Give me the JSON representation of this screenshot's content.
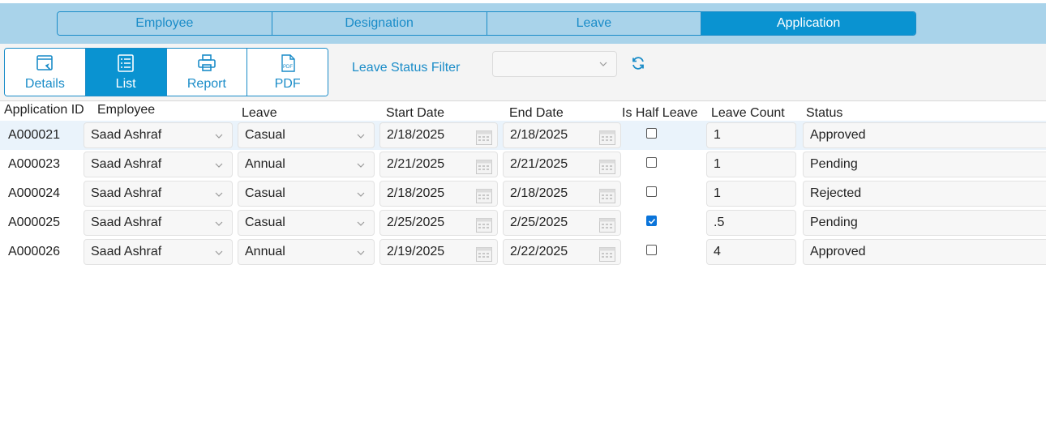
{
  "nav_tabs": [
    {
      "label": "Employee",
      "active": false
    },
    {
      "label": "Designation",
      "active": false
    },
    {
      "label": "Leave",
      "active": false
    },
    {
      "label": "Application",
      "active": true
    }
  ],
  "view_buttons": [
    {
      "label": "Details",
      "icon": "details-icon",
      "active": false
    },
    {
      "label": "List",
      "icon": "list-icon",
      "active": true
    },
    {
      "label": "Report",
      "icon": "printer-icon",
      "active": false
    },
    {
      "label": "PDF",
      "icon": "pdf-icon",
      "active": false
    }
  ],
  "filter": {
    "label": "Leave Status Filter",
    "value": ""
  },
  "table": {
    "columns": [
      "Application ID",
      "Employee",
      "Leave",
      "Start Date",
      "End Date",
      "Is Half Leave",
      "Leave Count",
      "Status"
    ],
    "rows": [
      {
        "id": "A000021",
        "employee": "Saad Ashraf",
        "leave": "Casual",
        "start": "2/18/2025",
        "end": "2/18/2025",
        "half": false,
        "count": "1",
        "status": "Approved",
        "selected": true
      },
      {
        "id": "A000023",
        "employee": "Saad Ashraf",
        "leave": "Annual",
        "start": "2/21/2025",
        "end": "2/21/2025",
        "half": false,
        "count": "1",
        "status": "Pending",
        "selected": false
      },
      {
        "id": "A000024",
        "employee": "Saad Ashraf",
        "leave": "Casual",
        "start": "2/18/2025",
        "end": "2/18/2025",
        "half": false,
        "count": "1",
        "status": "Rejected",
        "selected": false
      },
      {
        "id": "A000025",
        "employee": "Saad Ashraf",
        "leave": "Casual",
        "start": "2/25/2025",
        "end": "2/25/2025",
        "half": true,
        "count": ".5",
        "status": "Pending",
        "selected": false
      },
      {
        "id": "A000026",
        "employee": "Saad Ashraf",
        "leave": "Annual",
        "start": "2/19/2025",
        "end": "2/22/2025",
        "half": false,
        "count": "4",
        "status": "Approved",
        "selected": false
      }
    ]
  },
  "colors": {
    "accent": "#0a93d1",
    "nav_bg": "#a9d3ea",
    "link": "#1a8cc8"
  }
}
